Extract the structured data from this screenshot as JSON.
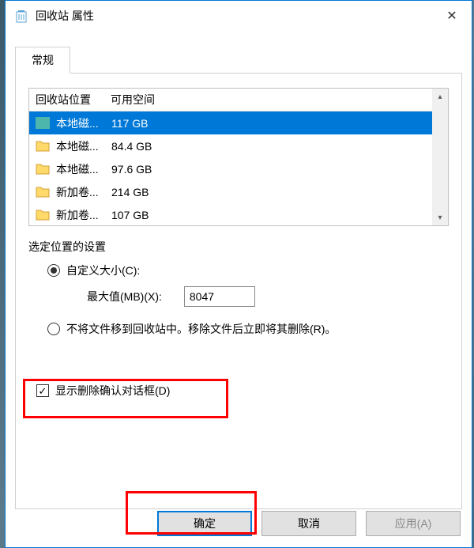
{
  "titlebar": {
    "title": "回收站 属性"
  },
  "tabs": {
    "general": "常规"
  },
  "table": {
    "header_location": "回收站位置",
    "header_space": "可用空间",
    "rows": [
      {
        "name": "本地磁...",
        "size": "117 GB"
      },
      {
        "name": "本地磁...",
        "size": "84.4 GB"
      },
      {
        "name": "本地磁...",
        "size": "97.6 GB"
      },
      {
        "name": "新加卷...",
        "size": "214 GB"
      },
      {
        "name": "新加卷...",
        "size": "107 GB"
      }
    ]
  },
  "settings": {
    "section_label": "选定位置的设置",
    "custom_size_label": "自定义大小(C):",
    "max_label": "最大值(MB)(X):",
    "max_value": "8047",
    "nodelete_label": "不将文件移到回收站中。移除文件后立即将其删除(R)。",
    "confirm_label": "显示删除确认对话框(D)"
  },
  "buttons": {
    "ok": "确定",
    "cancel": "取消",
    "apply": "应用(A)"
  }
}
